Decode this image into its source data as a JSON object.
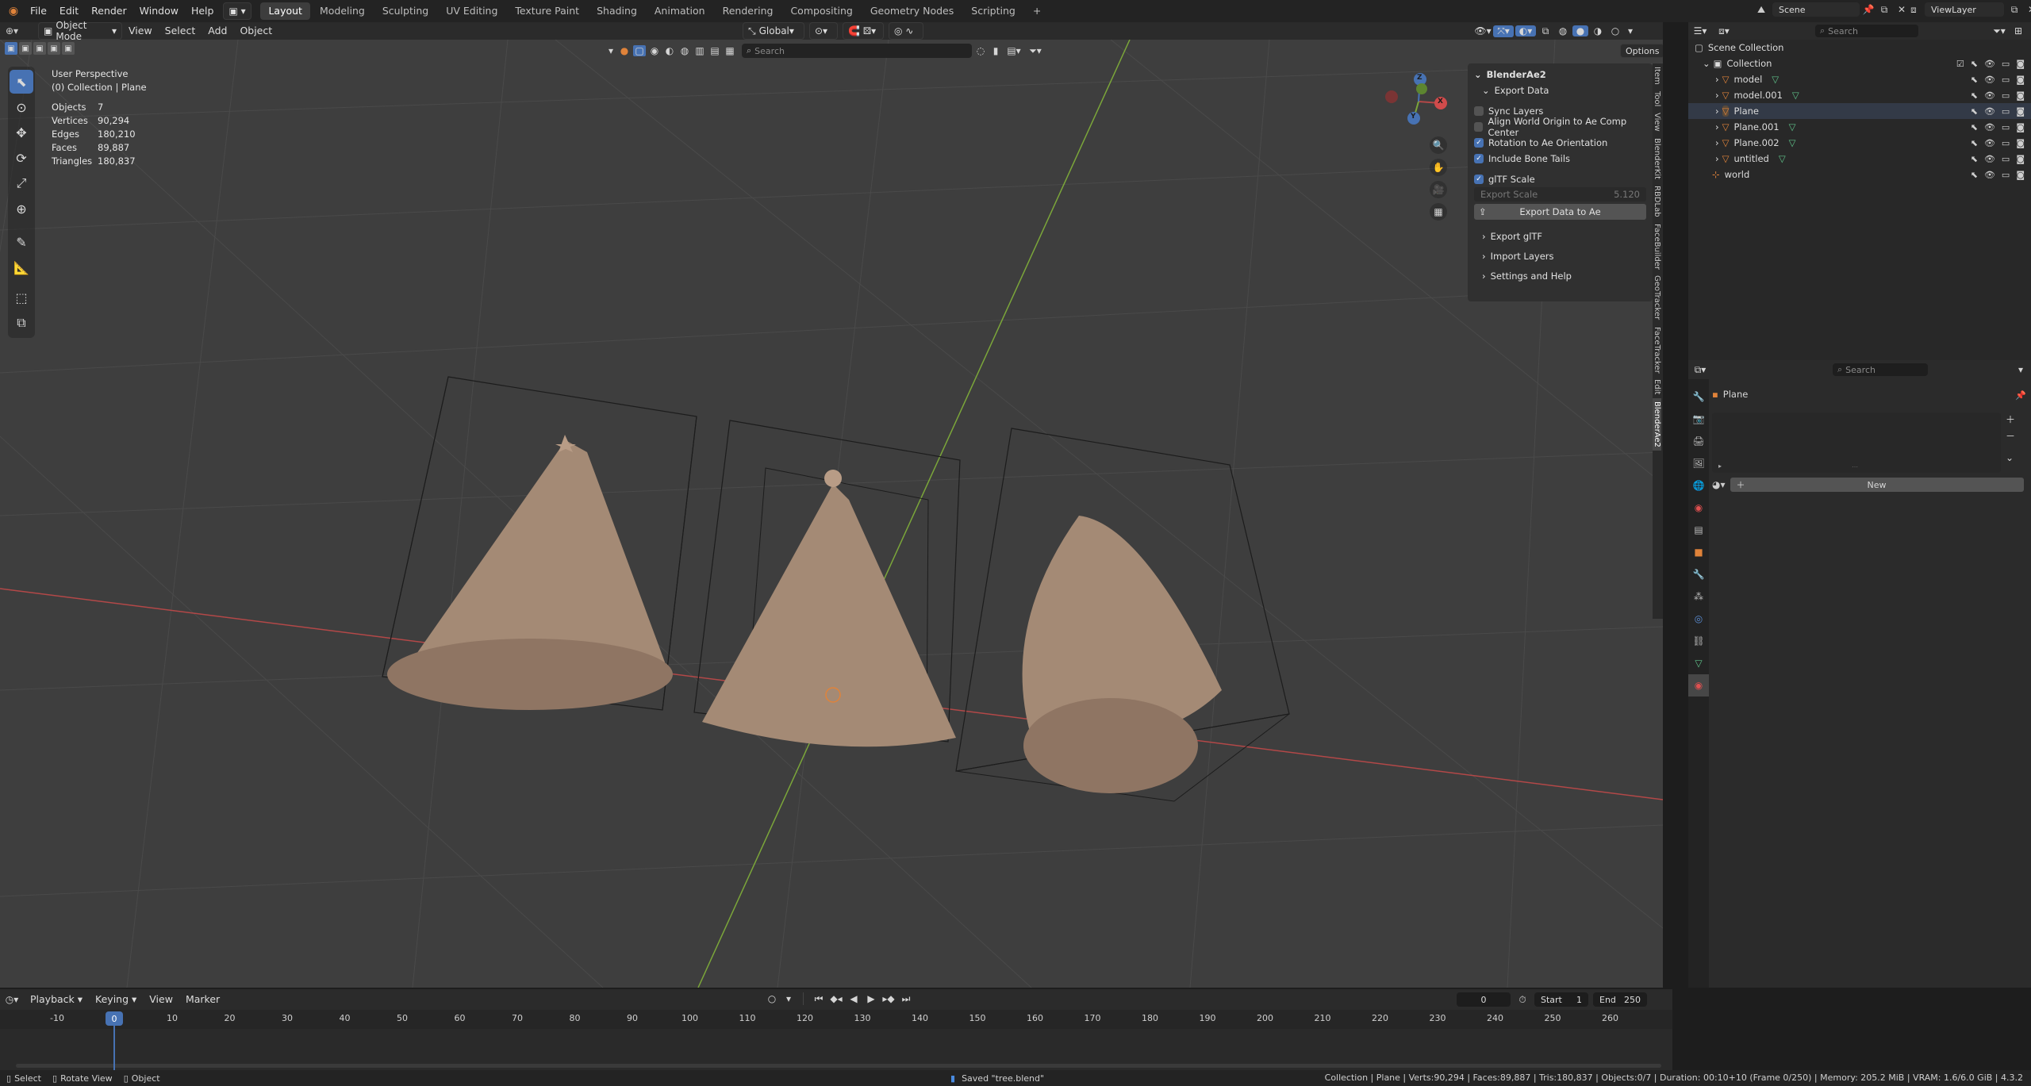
{
  "topbar": {
    "menus": [
      "File",
      "Edit",
      "Render",
      "Window",
      "Help"
    ],
    "workspaces": [
      "Layout",
      "Modeling",
      "Sculpting",
      "UV Editing",
      "Texture Paint",
      "Shading",
      "Animation",
      "Rendering",
      "Compositing",
      "Geometry Nodes",
      "Scripting"
    ],
    "active_workspace": "Layout",
    "add_tab": "+",
    "scene": "Scene",
    "view_layer": "ViewLayer"
  },
  "viewport": {
    "mode": "Object Mode",
    "menus": [
      "View",
      "Select",
      "Add",
      "Object"
    ],
    "orientation": "Global",
    "search_placeholder": "Search",
    "options": "Options",
    "view_name": "User Perspective",
    "collection_path": "(0) Collection | Plane",
    "stats": [
      {
        "label": "Objects",
        "value": "7"
      },
      {
        "label": "Vertices",
        "value": "90,294"
      },
      {
        "label": "Edges",
        "value": "180,210"
      },
      {
        "label": "Faces",
        "value": "89,887"
      },
      {
        "label": "Triangles",
        "value": "180,837"
      }
    ],
    "gizmo": {
      "x": "X",
      "y": "Y",
      "z": "Z"
    }
  },
  "npanel": {
    "addon": "BlenderAe2",
    "section": "Export Data",
    "checks": [
      {
        "label": "Sync Layers",
        "on": false
      },
      {
        "label": "Align World Origin to Ae Comp Center",
        "on": false
      },
      {
        "label": "Rotation to Ae Orientation",
        "on": true
      },
      {
        "label": "Include Bone Tails",
        "on": true
      }
    ],
    "gltf_scale": {
      "label": "glTF Scale",
      "on": true
    },
    "export_scale_label": "Export Scale",
    "export_scale_value": "5.120",
    "export_button": "Export Data to Ae",
    "subsections": [
      "Export glTF",
      "Import Layers",
      "Settings and Help"
    ],
    "tabs": [
      "Item",
      "Tool",
      "View",
      "BlenderKit",
      "RBDLab",
      "FaceBuilder",
      "GeoTracker",
      "FaceTracker",
      "Edit",
      "BlenderAe2"
    ],
    "active_tab": "BlenderAe2"
  },
  "outliner": {
    "search_placeholder": "Search",
    "root": "Scene Collection",
    "collection": "Collection",
    "items": [
      "model",
      "model.001",
      "Plane",
      "Plane.001",
      "Plane.002",
      "untitled"
    ],
    "selected": "Plane",
    "world": "world"
  },
  "properties": {
    "search_placeholder": "Search",
    "object": "Plane",
    "new_button": "New"
  },
  "timeline": {
    "menus": [
      "Playback",
      "Keying",
      "View",
      "Marker"
    ],
    "current_frame": "0",
    "start_label": "Start",
    "start": "1",
    "end_label": "End",
    "end": "250",
    "ticks": [
      "-10",
      "0",
      "10",
      "20",
      "30",
      "40",
      "50",
      "60",
      "70",
      "80",
      "90",
      "100",
      "110",
      "120",
      "130",
      "140",
      "150",
      "160",
      "170",
      "180",
      "190",
      "200",
      "210",
      "220",
      "230",
      "240",
      "250",
      "260"
    ]
  },
  "statusbar": {
    "select": "Select",
    "rotate": "Rotate View",
    "object": "Object",
    "saved": "Saved \"tree.blend\"",
    "info": "Collection | Plane | Verts:90,294 | Faces:89,887 | Tris:180,837 | Objects:0/7 | Duration: 00:10+10 (Frame 0/250) | Memory: 205.2 MiB | VRAM: 1.6/6.0 GiB | 4.3.2"
  },
  "colors": {
    "accent": "#4772b3",
    "viewport_bg": "#3e3e3e",
    "x_axis": "#b34848",
    "y_axis": "#7ba63a",
    "tree": "#a48a75",
    "orange": "#e0833a"
  }
}
